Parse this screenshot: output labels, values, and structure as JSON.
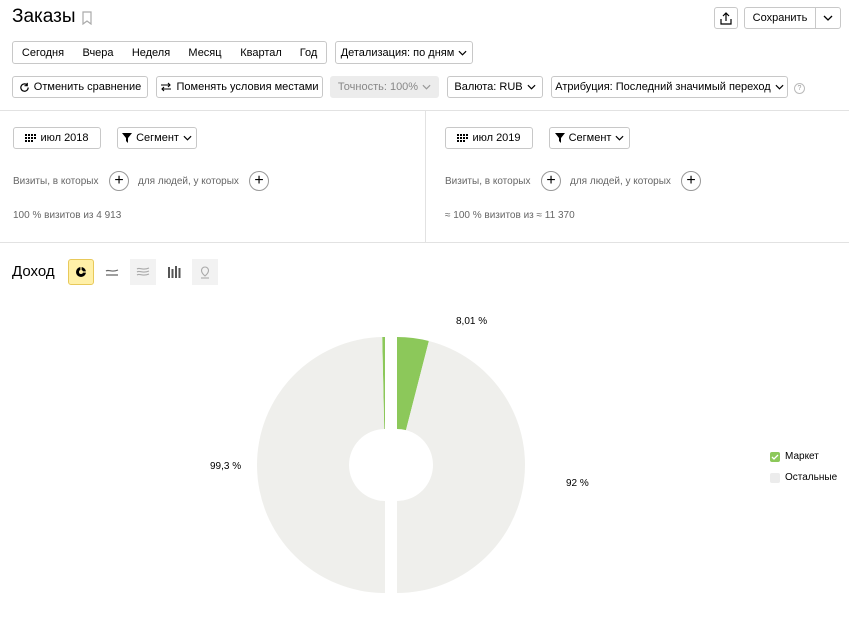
{
  "page": {
    "title": "Заказы"
  },
  "header": {
    "save_label": "Сохранить"
  },
  "periods": [
    "Сегодня",
    "Вчера",
    "Неделя",
    "Месяц",
    "Квартал",
    "Год"
  ],
  "detail": {
    "label": "Детализация: по дням"
  },
  "toolbar": {
    "cancel_compare": "Отменить сравнение",
    "swap_conditions": "Поменять условия местами",
    "accuracy": "Точность: 100%",
    "currency": "Валюта: RUB",
    "attribution": "Атрибуция: Последний значимый переход"
  },
  "left": {
    "date": "июл 2018",
    "segment": "Сегмент",
    "visits_label": "Визиты, в которых",
    "people_label": "для людей, у которых",
    "summary": "100 % визитов из 4 913"
  },
  "right": {
    "date": "июл 2019",
    "segment": "Сегмент",
    "visits_label": "Визиты, в которых",
    "people_label": "для людей, у которых",
    "summary": "≈ 100 % визитов из ≈ 11 370"
  },
  "chart": {
    "metric_label": "Доход"
  },
  "legend": [
    {
      "label": "Маркет",
      "color": "#8cc85a"
    },
    {
      "label": "Остальные",
      "color": "#ececec"
    }
  ],
  "chart_data": {
    "type": "pie",
    "series": [
      {
        "values": [
          0.7,
          99.3
        ],
        "labels": [
          "",
          "99,3 %"
        ]
      },
      {
        "values": [
          8.01,
          92
        ],
        "labels": [
          "8,01 %",
          "92 %"
        ]
      }
    ],
    "categories": [
      "Маркет",
      "Остальные"
    ],
    "colors": [
      "#8cc85a",
      "#efefec"
    ]
  }
}
